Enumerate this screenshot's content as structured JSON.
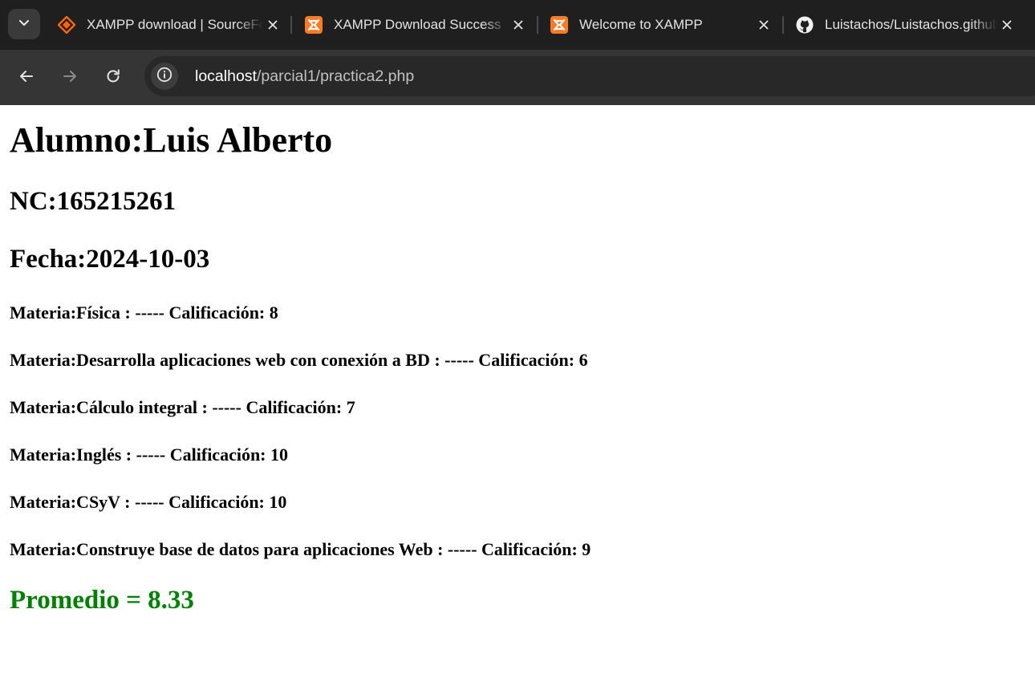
{
  "browser": {
    "tabs": [
      {
        "title": "XAMPP download | SourceForge.net",
        "favicon": "sourceforge-icon"
      },
      {
        "title": "XAMPP Download Success",
        "favicon": "xampp-icon"
      },
      {
        "title": "Welcome to XAMPP",
        "favicon": "xampp-icon"
      },
      {
        "title": "Luistachos/Luistachos.github.io",
        "favicon": "github-icon"
      }
    ],
    "url_host": "localhost",
    "url_path": "/parcial1/practica2.php",
    "colors": {
      "chrome_dark": "#1f1f1f",
      "toolbar": "#353535",
      "xampp_orange": "#fb7a24",
      "sourceforge_orange": "#ff6600"
    }
  },
  "page": {
    "alumno": "Alumno:Luis Alberto",
    "nc": "NC:165215261",
    "fecha": "Fecha:2024-10-03",
    "materias": [
      "Materia:Física : ----- Calificación: 8",
      "Materia:Desarrolla aplicaciones web con conexión a BD : ----- Calificación: 6",
      "Materia:Cálculo integral : ----- Calificación: 7",
      "Materia:Inglés : ----- Calificación: 10",
      "Materia:CSyV : ----- Calificación: 10",
      "Materia:Construye base de datos para aplicaciones Web : ----- Calificación: 9"
    ],
    "promedio": "Promedio = 8.33",
    "promedio_color": "#008000"
  }
}
